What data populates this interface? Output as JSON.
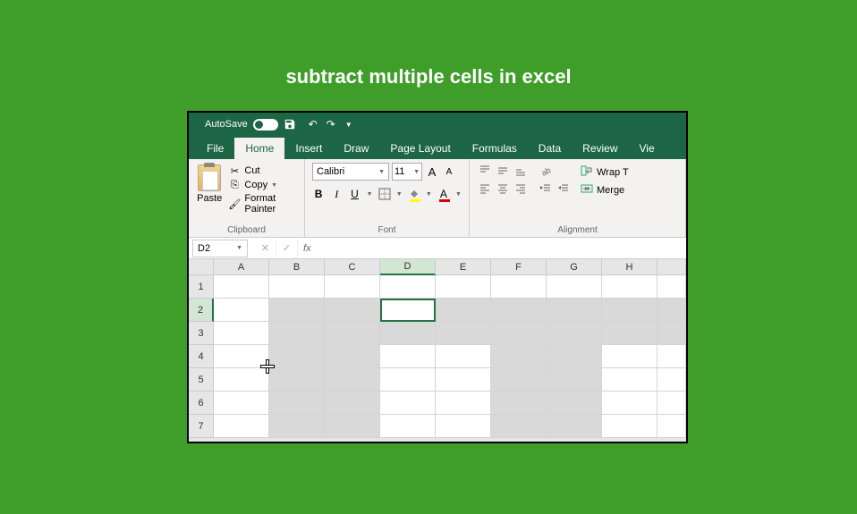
{
  "page_title": "subtract multiple cells in excel",
  "titlebar": {
    "autosave_label": "AutoSave",
    "autosave_state": "On"
  },
  "tabs": {
    "file": "File",
    "home": "Home",
    "insert": "Insert",
    "draw": "Draw",
    "page_layout": "Page Layout",
    "formulas": "Formulas",
    "data": "Data",
    "review": "Review",
    "view": "Vie"
  },
  "ribbon": {
    "clipboard": {
      "paste": "Paste",
      "cut": "Cut",
      "copy": "Copy",
      "format_painter": "Format Painter",
      "group_label": "Clipboard"
    },
    "font": {
      "name": "Calibri",
      "size": "11",
      "increase_label": "A",
      "decrease_label": "A",
      "bold": "B",
      "italic": "I",
      "underline": "U",
      "font_color_letter": "A",
      "group_label": "Font"
    },
    "alignment": {
      "wrap_text": "Wrap T",
      "merge": "Merge",
      "group_label": "Alignment"
    }
  },
  "formula_bar": {
    "name_box": "D2",
    "fx": "fx",
    "formula": ""
  },
  "sheet": {
    "columns": [
      "A",
      "B",
      "C",
      "D",
      "E",
      "F",
      "G",
      "H"
    ],
    "rows": [
      "1",
      "2",
      "3",
      "4",
      "5",
      "6",
      "7"
    ],
    "active_cell": "D2",
    "active_col": "D",
    "active_row": "2",
    "shaded_cells": [
      "B2",
      "C2",
      "D2",
      "E2",
      "F2",
      "G2",
      "H2",
      "I2",
      "B3",
      "C3",
      "D3",
      "E3",
      "F3",
      "G3",
      "H3",
      "I3",
      "B4",
      "C4",
      "F4",
      "G4",
      "B5",
      "C5",
      "F5",
      "G5",
      "B6",
      "C6",
      "F6",
      "G6",
      "B7",
      "C7",
      "F7",
      "G7"
    ],
    "cursor_position": {
      "col": "B",
      "row_between": "4-5"
    }
  }
}
